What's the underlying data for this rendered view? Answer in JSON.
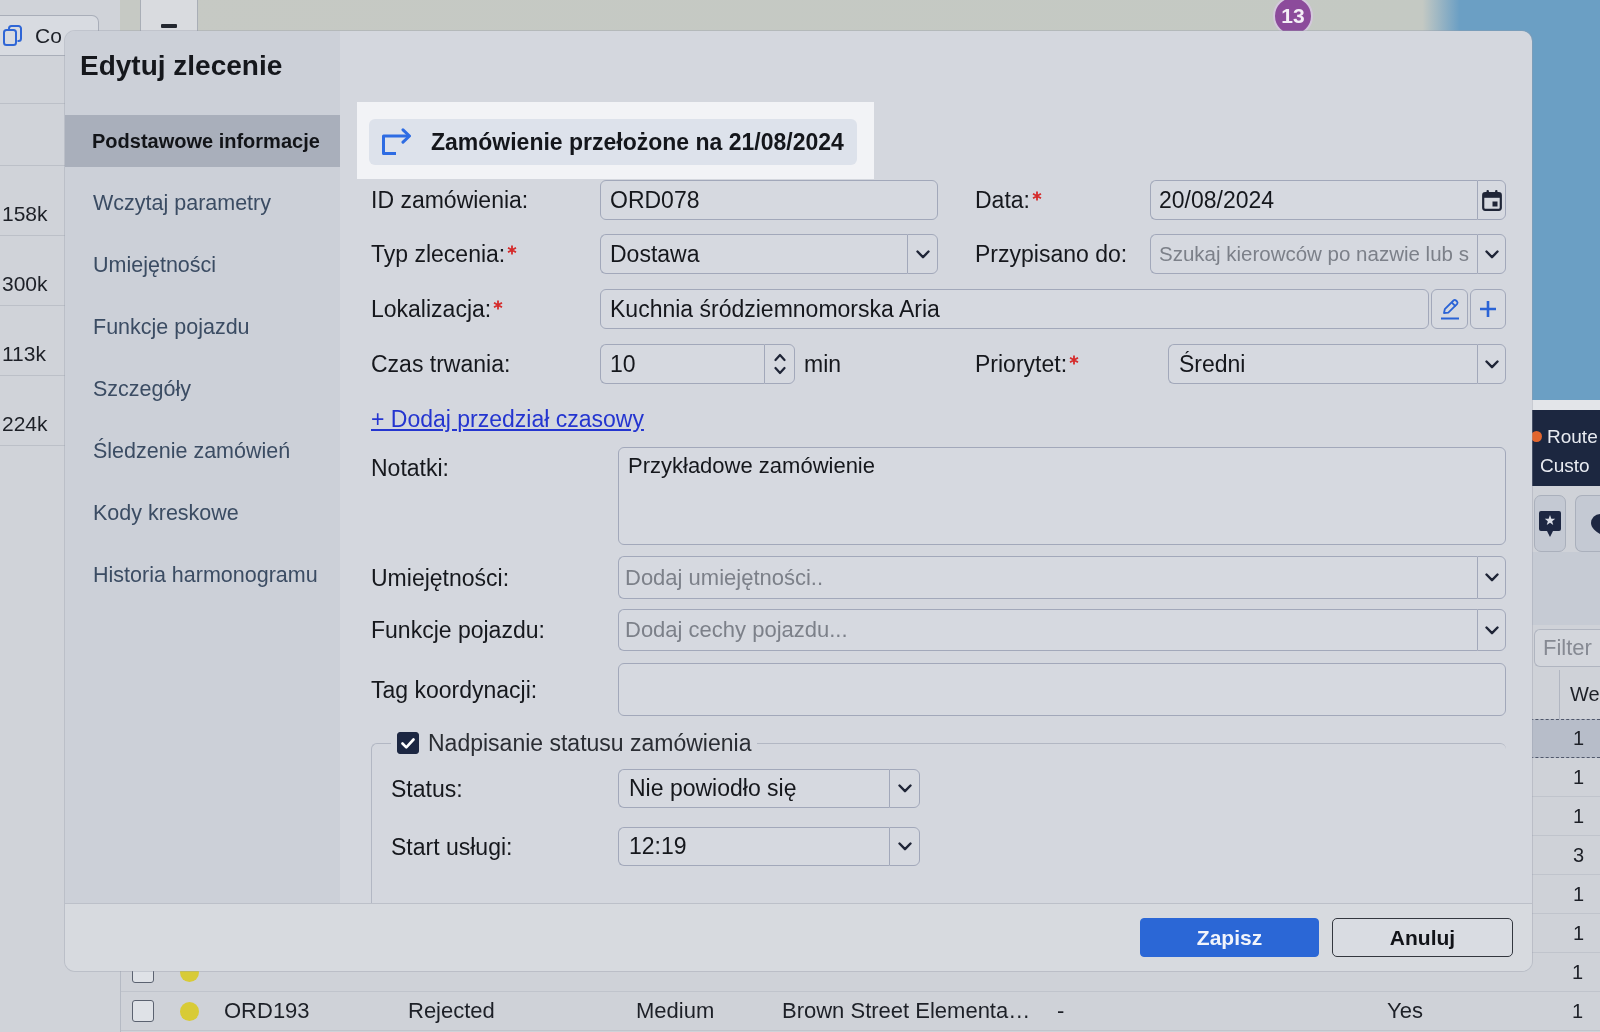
{
  "background": {
    "copy_button": {
      "label": "Co"
    },
    "distances": [
      "158k",
      "300k",
      "113k",
      "224k"
    ],
    "map": {
      "cluster": "13"
    },
    "legend": [
      {
        "label": "Route",
        "color": "#e2662e"
      },
      {
        "label": "Custo"
      }
    ],
    "filter": {
      "placeholder": "Filter"
    },
    "table": {
      "header": "We",
      "rows": [
        {
          "selected": true,
          "we": "1"
        },
        {
          "selected": false,
          "we": "1"
        },
        {
          "selected": false,
          "we": "1"
        },
        {
          "selected": false,
          "we": "3"
        },
        {
          "selected": false,
          "we": "1"
        },
        {
          "selected": false,
          "we": "1"
        },
        {
          "selected": false,
          "checked": false,
          "color": "#d8cb36",
          "we": "1"
        },
        {
          "selected": false,
          "checked": false,
          "color": "#d8cb36",
          "cells": [
            "ORD193",
            "Rejected",
            "Medium",
            "Brown Street Elementa…",
            "-",
            "Yes"
          ],
          "we": "1"
        }
      ]
    }
  },
  "dialog": {
    "title": "Edytuj zlecenie",
    "nav": [
      {
        "label": "Podstawowe informacje",
        "selected": true
      },
      {
        "label": "Wczytaj parametry",
        "selected": false
      },
      {
        "label": "Umiejętności",
        "selected": false
      },
      {
        "label": "Funkcje pojazdu",
        "selected": false
      },
      {
        "label": "Szczegóły",
        "selected": false
      },
      {
        "label": "Śledzenie zamówień",
        "selected": false
      },
      {
        "label": "Kody kreskowe",
        "selected": false
      },
      {
        "label": "Historia harmonogramu",
        "selected": false
      }
    ],
    "banner": {
      "text": "Zamówienie przełożone na 21/08/2024"
    },
    "fields": {
      "order_id": {
        "label": "ID zamówienia:",
        "value": "ORD078"
      },
      "date": {
        "label": "Data:",
        "required": true,
        "value": "20/08/2024"
      },
      "order_type": {
        "label": "Typ zlecenia:",
        "required": true,
        "value": "Dostawa"
      },
      "assigned_to": {
        "label": "Przypisano do:",
        "placeholder": "Szukaj kierowców po nazwie lub s"
      },
      "location": {
        "label": "Lokalizacja:",
        "required": true,
        "value": "Kuchnia śródziemnomorska Aria"
      },
      "duration": {
        "label": "Czas trwania:",
        "value": "10",
        "unit": "min"
      },
      "priority": {
        "label": "Priorytet:",
        "required": true,
        "value": "Średni"
      },
      "notes": {
        "label": "Notatki:",
        "value": "Przykładowe zamówienie"
      },
      "skills": {
        "label": "Umiejętności:",
        "placeholder": "Dodaj umiejętności.."
      },
      "vehicle_features": {
        "label": "Funkcje pojazdu:",
        "placeholder": "Dodaj cechy pojazdu..."
      },
      "coordination_tag": {
        "label": "Tag koordynacji:"
      }
    },
    "time_window_link": "+ Dodaj przedział czasowy",
    "status_override": {
      "checked": true,
      "label": "Nadpisanie statusu zamówienia",
      "fields": [
        {
          "label": "Status:",
          "value": "Nie powiodło się"
        },
        {
          "label": "Start usługi:",
          "value": "12:19"
        }
      ]
    },
    "buttons": [
      {
        "label": "Zapisz",
        "kind": "primary"
      },
      {
        "label": "Anuluj",
        "kind": "secondary"
      }
    ]
  }
}
